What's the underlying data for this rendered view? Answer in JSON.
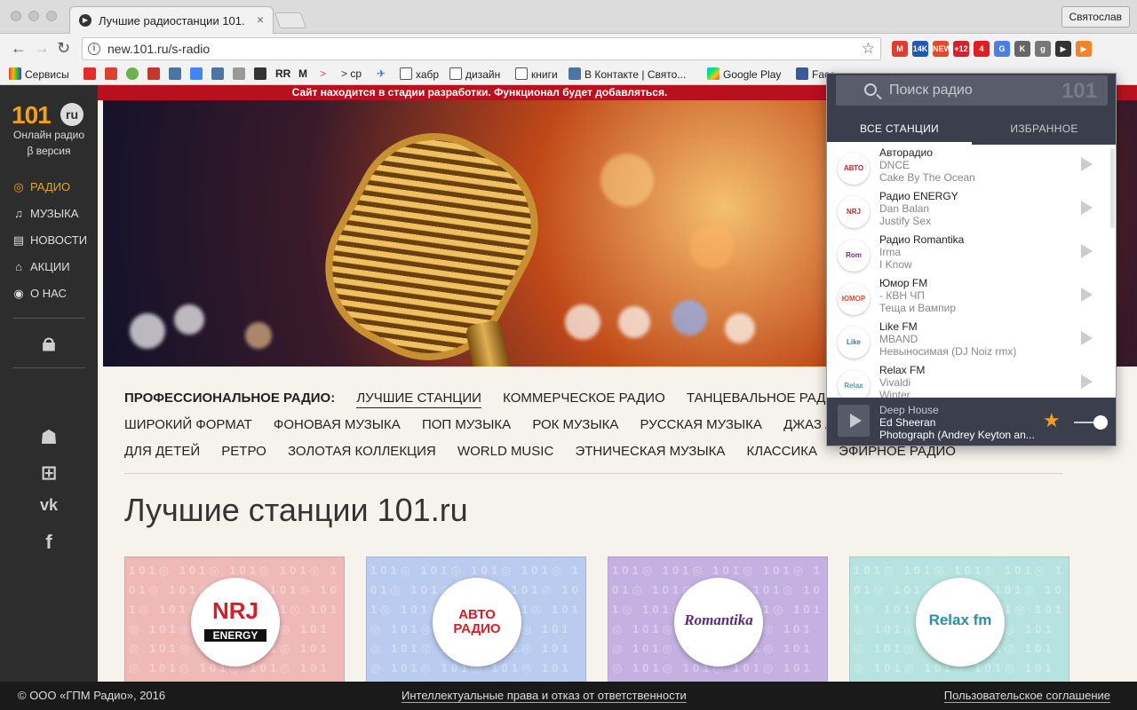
{
  "browser": {
    "tab_title": "Лучшие радиостанции 101.ru",
    "tab_close": "×",
    "profile_name": "Святослав",
    "url": "new.101.ru/s-radio",
    "extensions": [
      {
        "name": "gmail",
        "label": "M",
        "color": "#e03b2f"
      },
      {
        "name": "ext-14k",
        "label": "14K",
        "color": "#1d5ab8"
      },
      {
        "name": "ext-new",
        "label": "NEW",
        "color": "#e04a2a"
      },
      {
        "name": "ext-12",
        "label": "+12",
        "color": "#d4222b"
      },
      {
        "name": "ext-4",
        "label": "4",
        "color": "#e02020"
      },
      {
        "name": "translate",
        "label": "G",
        "color": "#4b7fe0"
      },
      {
        "name": "ext-k",
        "label": "K",
        "color": "#666"
      },
      {
        "name": "ext-g",
        "label": "g",
        "color": "#777"
      },
      {
        "name": "ext-play",
        "label": "▶",
        "color": "#333"
      },
      {
        "name": "radio-101",
        "label": "▶",
        "color": "#f0842a"
      }
    ],
    "bookmarks": [
      "Сервисы",
      "",
      "",
      "",
      "",
      "",
      "",
      "",
      "RR",
      "M",
      "",
      "ср",
      "",
      "хабр",
      "дизайн",
      "книги",
      "В Контакте | Свято...",
      "Google Play",
      "Face"
    ]
  },
  "site": {
    "notice": "Сайт находится в стадии разработки. Функционал будет добавляться.",
    "logo": "101",
    "logo_ru": "ru",
    "logo_line1": "Онлайн радио",
    "logo_line2": "β версия",
    "nav": [
      {
        "label": "РАДИО",
        "icon": "radio-icon"
      },
      {
        "label": "МУЗЫКА",
        "icon": "music-icon"
      },
      {
        "label": "НОВОСТИ",
        "icon": "news-icon"
      },
      {
        "label": "АКЦИИ",
        "icon": "gift-icon"
      },
      {
        "label": "О НАС",
        "icon": "play-circle-icon"
      }
    ],
    "categories_title": "ПРОФЕССИОНАЛЬНОЕ РАДИО:",
    "categories": [
      [
        "ЛУЧШИЕ СТАНЦИИ",
        "КОММЕРЧЕСКОЕ РАДИО",
        "ТАНЦЕВАЛЬНОЕ РАДИО"
      ],
      [
        "ШИРОКИЙ ФОРМАТ",
        "ФОНОВАЯ МУЗЫКА",
        "ПОП МУЗЫКА",
        "РОК МУЗЫКА",
        "РУССКАЯ МУЗЫКА",
        "ДЖАЗ / БЛЮЗ"
      ],
      [
        "ДЛЯ ДЕТЕЙ",
        "РЕТРО",
        "ЗОЛОТАЯ КОЛЛЕКЦИЯ",
        "WORLD MUSIC",
        "ЭТНИЧЕСКАЯ МУЗЫКА",
        "КЛАССИКА",
        "ЭФИРНОЕ РАДИО"
      ]
    ],
    "heading": "Лучшие станции 101.ru",
    "cards": [
      {
        "logo": "ENERGY",
        "bg": "#efb9b8"
      },
      {
        "logo": "АВТО РАДИО",
        "bg": "#b9cbee"
      },
      {
        "logo": "Romantika",
        "bg": "#c4b1e2"
      },
      {
        "logo": "Relax fm",
        "bg": "#b6e3e0"
      }
    ],
    "card_pattern": "101",
    "footer_copy": "© ООО «ГПМ Радио», 2016",
    "footer_rights": "Интеллектуальные права и отказ от ответственности",
    "footer_agreement": "Пользовательское соглашение"
  },
  "popup": {
    "search_placeholder": "Поиск радио",
    "search_logo": "101",
    "tab_all": "ВСЕ СТАНЦИИ",
    "tab_fav": "ИЗБРАННОЕ",
    "stations": [
      {
        "name": "Авторадио",
        "artist": "DNCE",
        "track": "Cake By The Ocean",
        "logo": "АВТО",
        "color": "#d32027"
      },
      {
        "name": "Радио ENERGY",
        "artist": "Dan Balan",
        "track": "Justify Sex",
        "logo": "NRJ",
        "color": "#d32027"
      },
      {
        "name": "Радио Romantika",
        "artist": "Irma",
        "track": "I Know",
        "logo": "Rom",
        "color": "#6b2c86"
      },
      {
        "name": "Юмор FM",
        "artist": "- КВН ЧП",
        "track": "Теща и Вампир",
        "logo": "ЮМОР",
        "color": "#e6482a"
      },
      {
        "name": "Like FM",
        "artist": "MBAND",
        "track": "Невыносимая (DJ Noiz rmx)",
        "logo": "Like",
        "color": "#2a7cc4"
      },
      {
        "name": "Relax FM",
        "artist": "Vivaldi",
        "track": "Winter",
        "logo": "Relax",
        "color": "#3aa6b4"
      }
    ],
    "player": {
      "station": "Deep House",
      "artist": "Ed Sheeran",
      "track": "Photograph (Andrey Keyton an..."
    }
  }
}
